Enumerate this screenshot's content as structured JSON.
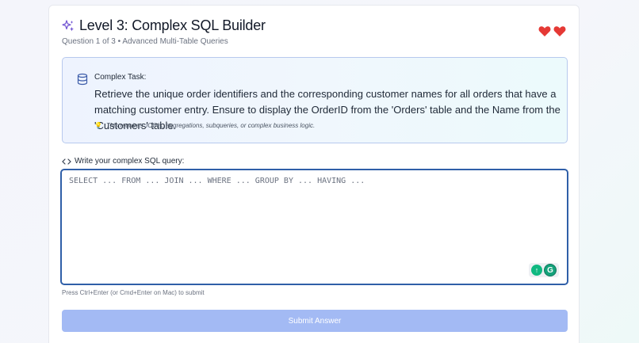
{
  "header": {
    "title": "Level 3: Complex SQL Builder",
    "subtitle": "Question 1 of 3 • Advanced Multi-Table Queries",
    "lives": 2
  },
  "task": {
    "label": "Complex Task:",
    "text": "Retrieve the unique order identifiers and the corresponding customer names for all orders that have a matching customer entry. Ensure to display the OrderID from the 'Orders' table and the Name from the 'Customers' table.",
    "hint": "This requires JOINs, aggregations, subqueries, or complex business logic."
  },
  "query": {
    "label": "Write your complex SQL query:",
    "placeholder": "SELECT ... FROM ... JOIN ... WHERE ... GROUP BY ... HAVING ...",
    "value": ""
  },
  "shortcut_hint": "Press Ctrl+Enter (or Cmd+Enter on Mac) to submit",
  "submit_label": "Submit Answer",
  "colors": {
    "accent": "#2f5fa8",
    "heart": "#e53935",
    "submit_disabled": "#a3baf4",
    "sparkle": "#7c5cd6"
  },
  "icons": [
    "sparkle-icon",
    "heart-icon",
    "database-icon",
    "lightbulb-icon",
    "code-icon",
    "grammarly-icon"
  ]
}
